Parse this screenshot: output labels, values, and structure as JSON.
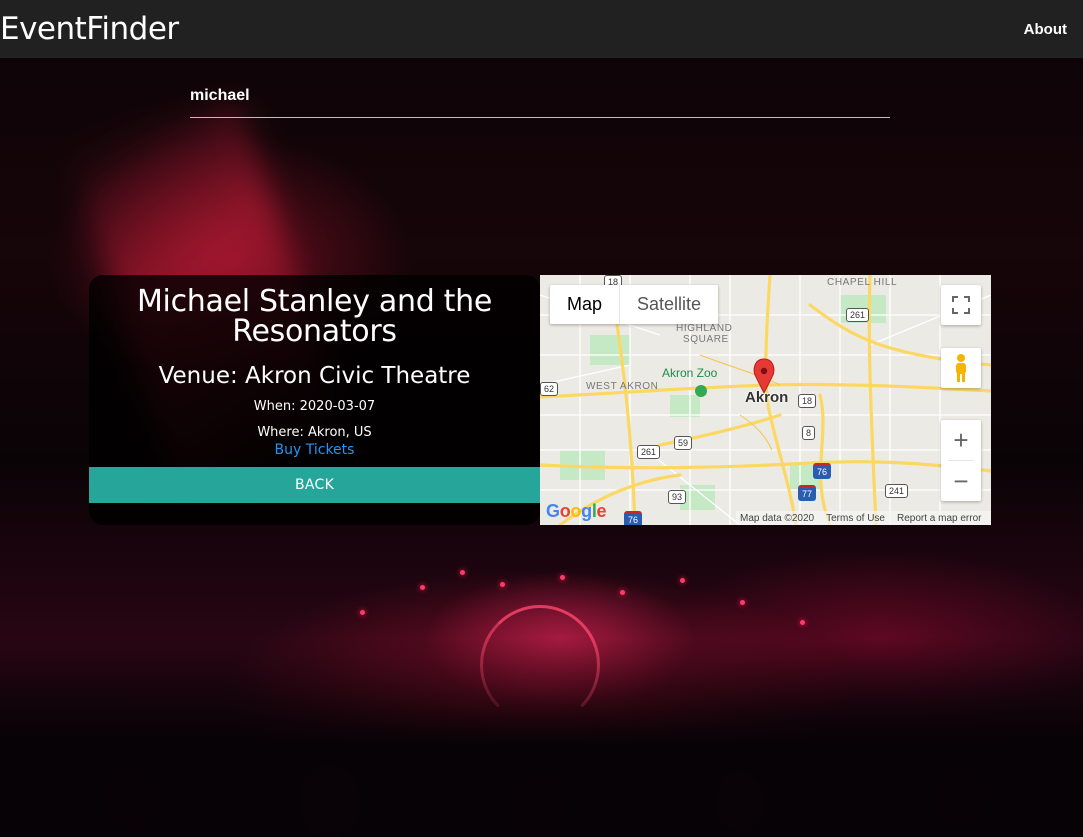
{
  "navbar": {
    "brand": "EventFinder",
    "about_label": "About"
  },
  "search": {
    "value": "michael"
  },
  "event": {
    "title": "Michael Stanley and the Resonators",
    "venue": "Venue: Akron Civic Theatre",
    "when": "When: 2020-03-07",
    "where": "Where: Akron, US",
    "tickets_label": "Buy Tickets",
    "back_label": "BACK"
  },
  "map": {
    "type_map_label": "Map",
    "type_satellite_label": "Satellite",
    "zoom_in_label": "+",
    "zoom_out_label": "−",
    "city_label": "Akron",
    "poi_label": "Akron Zoo",
    "neighborhoods": {
      "chapel_hill": "CHAPEL HILL",
      "highland_square_1": "HIGHLAND",
      "highland_square_2": "SQUARE",
      "west_akron": "WEST AKRON"
    },
    "route_shields": {
      "r18_top": "18",
      "r261_top": "261",
      "r62": "62",
      "r18_center": "18",
      "r8": "8",
      "r59": "59",
      "r261_left": "261",
      "r76": "76",
      "r93": "93",
      "r77": "77",
      "r76_bottom": "76",
      "r241": "241"
    },
    "google_logo": "Google",
    "attribution": {
      "data": "Map data ©2020",
      "terms": "Terms of Use",
      "report": "Report a map error"
    },
    "colors": {
      "land": "#eceae4",
      "major_road": "#fbd864",
      "minor_road": "#ffffff",
      "park": "#c5e8c5",
      "marker": "#e53935"
    }
  },
  "colors": {
    "navbar_bg": "#212121",
    "back_button_bg": "#26a69a",
    "link": "#2196f3"
  }
}
